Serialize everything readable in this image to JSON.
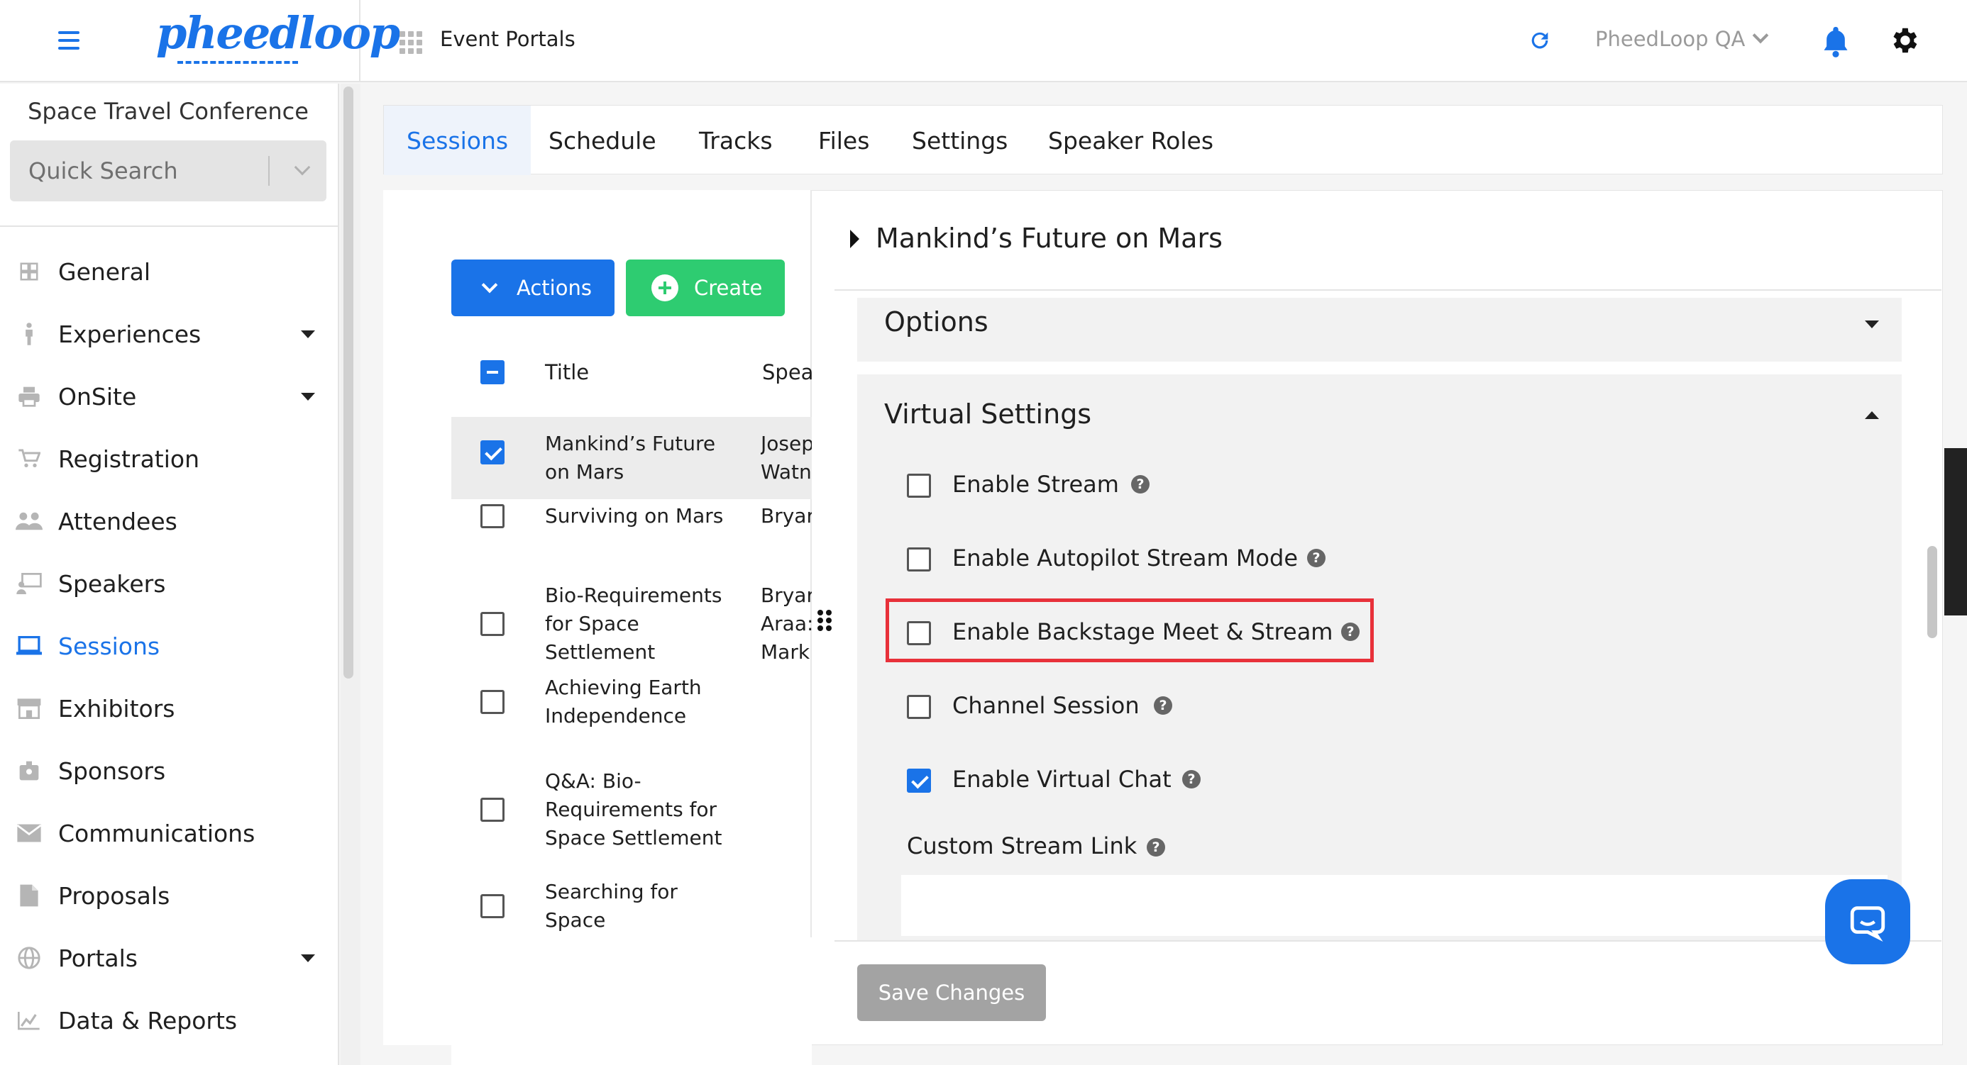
{
  "app": {
    "logo_text": "pheedloop",
    "top_title": "Event Portals",
    "org_name": "PheedLoop QA",
    "icons": [
      "hamburger-icon",
      "app-grid-icon",
      "refresh-icon",
      "chevron-down-icon",
      "bell-icon",
      "gear-icon"
    ]
  },
  "sidebar": {
    "event_name": "Space Travel Conference",
    "search_placeholder": "Quick Search",
    "items": [
      {
        "label": "General",
        "icon": "grid-icon"
      },
      {
        "label": "Experiences",
        "icon": "person-icon",
        "expandable": true
      },
      {
        "label": "OnSite",
        "icon": "printer-icon",
        "expandable": true
      },
      {
        "label": "Registration",
        "icon": "cart-icon"
      },
      {
        "label": "Attendees",
        "icon": "people-icon"
      },
      {
        "label": "Speakers",
        "icon": "presenter-icon"
      },
      {
        "label": "Sessions",
        "icon": "laptop-icon",
        "active": true
      },
      {
        "label": "Exhibitors",
        "icon": "storefront-icon"
      },
      {
        "label": "Sponsors",
        "icon": "badge-icon"
      },
      {
        "label": "Communications",
        "icon": "envelope-icon"
      },
      {
        "label": "Proposals",
        "icon": "document-icon"
      },
      {
        "label": "Portals",
        "icon": "globe-icon",
        "expandable": true
      },
      {
        "label": "Data & Reports",
        "icon": "chart-icon"
      }
    ]
  },
  "tabs": [
    {
      "label": "Sessions",
      "active": true
    },
    {
      "label": "Schedule"
    },
    {
      "label": "Tracks"
    },
    {
      "label": "Files"
    },
    {
      "label": "Settings"
    },
    {
      "label": "Speaker Roles"
    }
  ],
  "list": {
    "actions_label": "Actions",
    "create_label": "Create",
    "columns": [
      "Title",
      "Spea"
    ],
    "rows": [
      {
        "title": [
          "Mankind’s Future",
          "on Mars"
        ],
        "speaker": [
          "Josep",
          "Watn"
        ],
        "checked": true
      },
      {
        "title": [
          "Surviving on Mars"
        ],
        "speaker": [
          "Bryar"
        ],
        "checked": false
      },
      {
        "title": [
          "Bio-Requirements",
          "for Space",
          "Settlement"
        ],
        "speaker": [
          "Bryar",
          "Araa:",
          "Mark"
        ],
        "checked": false
      },
      {
        "title": [
          "Achieving Earth",
          "Independence"
        ],
        "speaker": [],
        "checked": false
      },
      {
        "title": [
          "Q&A: Bio-",
          "Requirements for",
          "Space Settlement"
        ],
        "speaker": [],
        "checked": false
      },
      {
        "title": [
          "Searching for",
          "Space"
        ],
        "speaker": [],
        "checked": false
      }
    ]
  },
  "detail": {
    "session_title": "Mankind’s Future on Mars",
    "options_title": "Options",
    "virtual_settings_title": "Virtual Settings",
    "settings": [
      {
        "label": "Enable Stream",
        "checked": false
      },
      {
        "label": "Enable Autopilot Stream Mode",
        "checked": false
      },
      {
        "label": "Enable Backstage Meet & Stream",
        "checked": false,
        "highlighted": true
      },
      {
        "label": "Channel Session",
        "checked": false
      },
      {
        "label": "Enable Virtual Chat",
        "checked": true
      }
    ],
    "custom_stream_label": "Custom Stream Link",
    "custom_stream_value": "",
    "save_label": "Save Changes",
    "help_glyph": "?",
    "highlight_color": "#e8313a"
  },
  "colors": {
    "accent": "#1a73e8",
    "create_green": "#2ecc71",
    "save_disabled": "#a3a3a3"
  }
}
